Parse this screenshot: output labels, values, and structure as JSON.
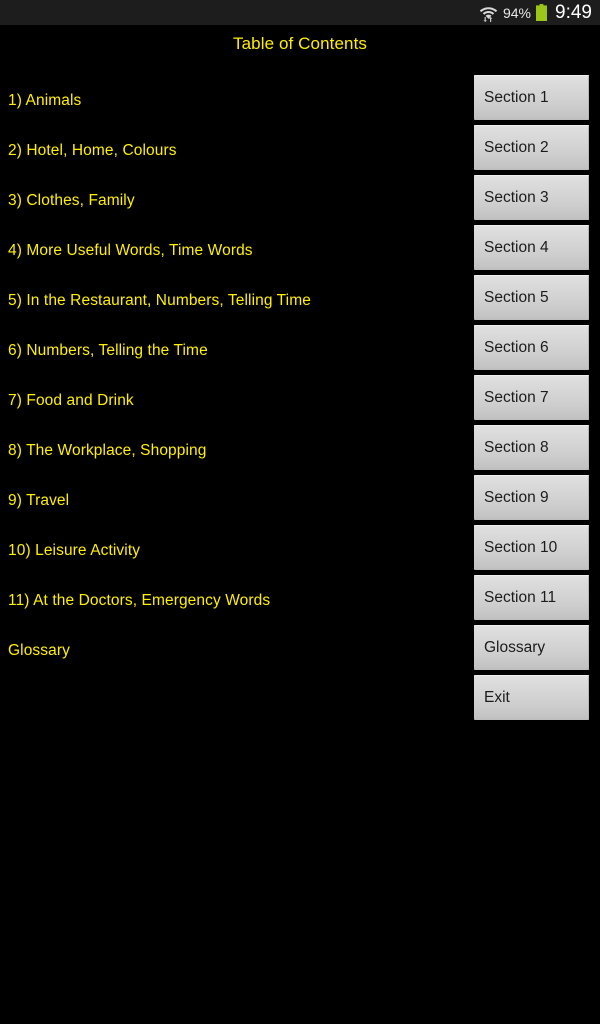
{
  "status_bar": {
    "wifi_icon": "wifi-with-data-arrows-icon",
    "battery_percent": "94%",
    "battery_icon": "battery-full-icon",
    "battery_color": "#9bc519",
    "clock": "9:49"
  },
  "header": {
    "title": "Table of Contents",
    "title_color": "#ffee00"
  },
  "toc": {
    "items": [
      {
        "label": "1) Animals"
      },
      {
        "label": "2) Hotel, Home, Colours"
      },
      {
        "label": "3) Clothes, Family"
      },
      {
        "label": "4) More Useful Words, Time Words"
      },
      {
        "label": "5) In the Restaurant, Numbers, Telling Time"
      },
      {
        "label": "6) Numbers, Telling the Time"
      },
      {
        "label": "7) Food and Drink"
      },
      {
        "label": "8) The Workplace, Shopping"
      },
      {
        "label": "9) Travel"
      },
      {
        "label": "10) Leisure Activity"
      },
      {
        "label": "11) At the Doctors, Emergency Words"
      },
      {
        "label": "Glossary"
      }
    ]
  },
  "buttons": [
    {
      "label": "Section 1"
    },
    {
      "label": "Section 2"
    },
    {
      "label": "Section 3"
    },
    {
      "label": "Section 4"
    },
    {
      "label": "Section 5"
    },
    {
      "label": "Section 6"
    },
    {
      "label": "Section 7"
    },
    {
      "label": "Section 8"
    },
    {
      "label": "Section 9"
    },
    {
      "label": "Section 10"
    },
    {
      "label": "Section 11"
    },
    {
      "label": "Glossary"
    },
    {
      "label": "Exit"
    }
  ]
}
